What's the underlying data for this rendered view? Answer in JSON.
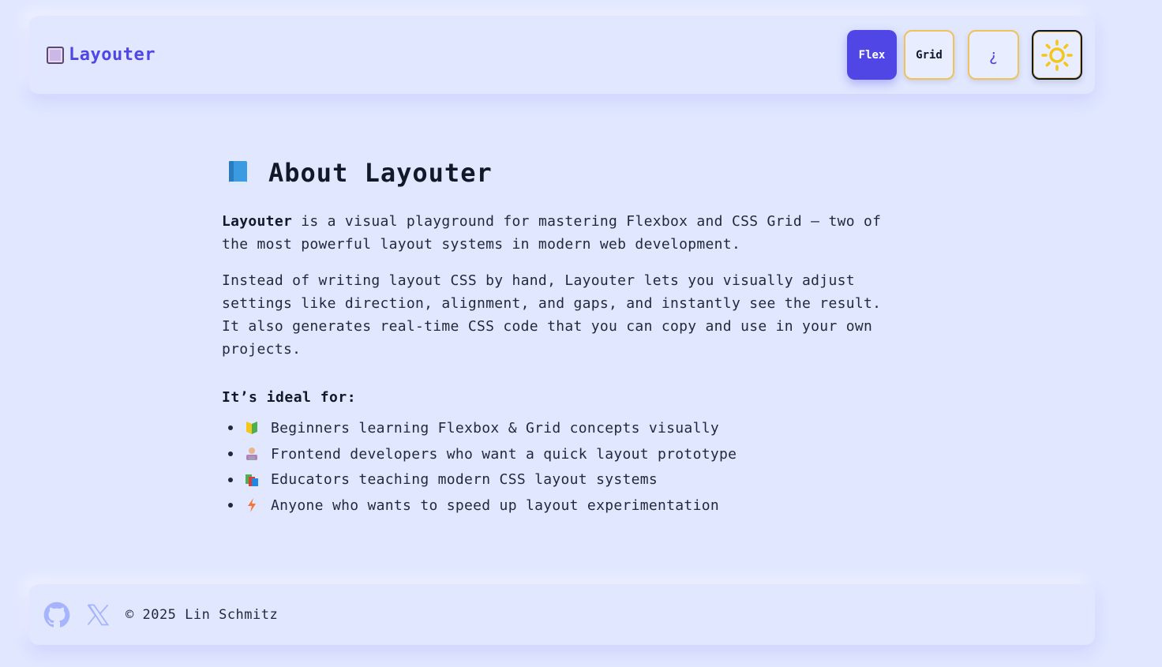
{
  "header": {
    "brand_name": "Layouter",
    "brand_icon": "window-icon",
    "nav": {
      "flex_label": "Flex",
      "grid_label": "Grid",
      "help_label": "¿",
      "theme_icon": "sun-icon"
    }
  },
  "main": {
    "title": "About Layouter",
    "title_icon": "book-icon",
    "intro_bold": "Layouter",
    "intro_rest": " is a visual playground for mastering Flexbox and CSS Grid – two of the most powerful layout systems in modern web development.",
    "paragraph2": "Instead of writing layout CSS by hand, Layouter lets you visually adjust settings like direction, alignment, and gaps, and instantly see the result. It also generates real-time CSS code that you can copy and use in your own projects.",
    "ideal_heading": "It’s ideal for:",
    "ideal_items": [
      {
        "icon": "beginner-badge-icon",
        "text": "Beginners learning Flexbox & Grid concepts visually"
      },
      {
        "icon": "developer-icon",
        "text": "Frontend developers who want a quick layout prototype"
      },
      {
        "icon": "books-icon",
        "text": "Educators teaching modern CSS layout systems"
      },
      {
        "icon": "lightning-icon",
        "text": "Anyone who wants to speed up layout experimentation"
      }
    ]
  },
  "footer": {
    "github_icon": "github-icon",
    "x_icon": "x-icon",
    "copyright": "© 2025 Lin Schmitz"
  },
  "colors": {
    "background": "#e0e7ff",
    "accent": "#4f46e5",
    "button_border": "#f0c25a",
    "sun": "#f5c518"
  }
}
